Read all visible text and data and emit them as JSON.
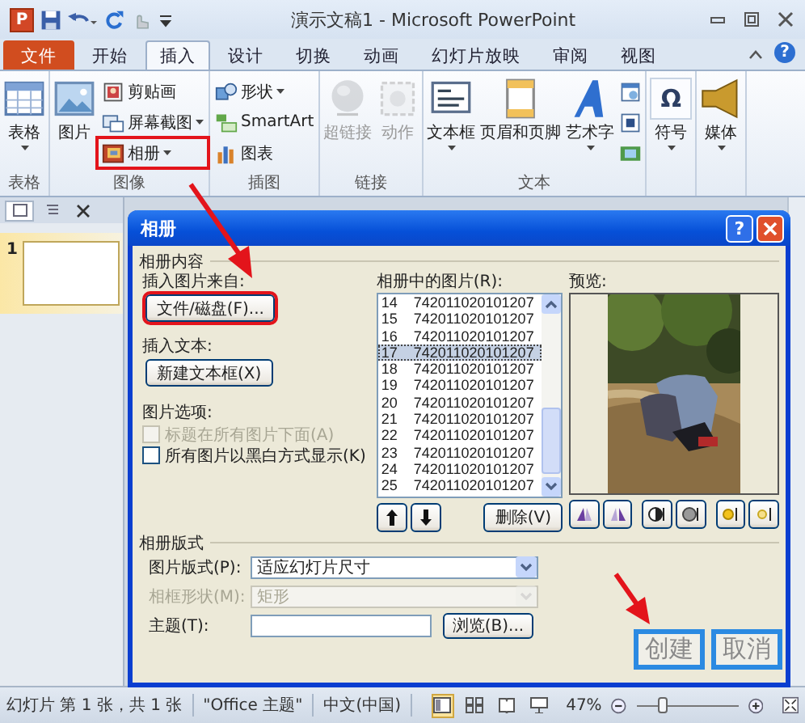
{
  "window": {
    "app_icon": "P",
    "title": "演示文稿1 - Microsoft PowerPoint"
  },
  "ribbon_tabs": [
    {
      "label": "文件",
      "kind": "file",
      "selected": false
    },
    {
      "label": "开始",
      "kind": "tab",
      "selected": false
    },
    {
      "label": "插入",
      "kind": "tab",
      "selected": true
    },
    {
      "label": "设计",
      "kind": "tab",
      "selected": false
    },
    {
      "label": "切换",
      "kind": "tab",
      "selected": false
    },
    {
      "label": "动画",
      "kind": "tab",
      "selected": false
    },
    {
      "label": "幻灯片放映",
      "kind": "tab",
      "selected": false
    },
    {
      "label": "审阅",
      "kind": "tab",
      "selected": false
    },
    {
      "label": "视图",
      "kind": "tab",
      "selected": false
    }
  ],
  "ribbon_help": "?",
  "ribbon_groups": [
    {
      "label": "表格",
      "items": [
        {
          "label": "表格",
          "kind": "large",
          "dropdown": true,
          "disabled": false,
          "marked": false
        }
      ]
    },
    {
      "label": "图像",
      "items": [
        {
          "label": "图片",
          "kind": "large",
          "dropdown": false,
          "disabled": false,
          "marked": false
        },
        {
          "label": "剪贴画",
          "kind": "small",
          "dropdown": false,
          "disabled": false,
          "marked": false
        },
        {
          "label": "屏幕截图",
          "kind": "small",
          "dropdown": true,
          "disabled": false,
          "marked": false
        },
        {
          "label": "相册",
          "kind": "small",
          "dropdown": true,
          "disabled": false,
          "marked": true
        }
      ]
    },
    {
      "label": "插图",
      "items": [
        {
          "label": "形状",
          "kind": "small",
          "dropdown": true,
          "disabled": false,
          "marked": false
        },
        {
          "label": "SmartArt",
          "kind": "small",
          "dropdown": false,
          "disabled": false,
          "marked": false
        },
        {
          "label": "图表",
          "kind": "small",
          "dropdown": false,
          "disabled": false,
          "marked": false
        }
      ]
    },
    {
      "label": "链接",
      "items": [
        {
          "label": "超链接",
          "kind": "large",
          "dropdown": false,
          "disabled": true,
          "marked": false
        },
        {
          "label": "动作",
          "kind": "large",
          "dropdown": false,
          "disabled": true,
          "marked": false
        }
      ]
    },
    {
      "label": "文本",
      "items": [
        {
          "label": "文本框",
          "kind": "large",
          "dropdown": true,
          "disabled": false,
          "marked": false
        },
        {
          "label": "页眉和页脚",
          "kind": "large",
          "dropdown": false,
          "disabled": false,
          "marked": false
        },
        {
          "label": "艺术字",
          "kind": "large",
          "dropdown": true,
          "disabled": false,
          "marked": false
        },
        {
          "kind": "icon",
          "disabled": false,
          "marked": false
        },
        {
          "kind": "icon",
          "disabled": false,
          "marked": false
        },
        {
          "kind": "icon",
          "disabled": false,
          "marked": false
        }
      ]
    },
    {
      "items": [
        {
          "label": "符号",
          "glyph": "Ω",
          "kind": "large",
          "dropdown": true,
          "disabled": false,
          "marked": false
        }
      ]
    },
    {
      "items": [
        {
          "label": "媒体",
          "kind": "large",
          "dropdown": true,
          "disabled": false,
          "marked": false
        }
      ]
    }
  ],
  "slides_pane": {
    "tabs": [
      {
        "kind": "slides",
        "selected": true
      },
      {
        "kind": "outline",
        "selected": false
      }
    ],
    "slides": [
      {
        "number": "1",
        "selected": true
      }
    ]
  },
  "dialog": {
    "title": "相册",
    "help_button": "?",
    "content_section": "相册内容",
    "insert_from_label": "插入图片来自:",
    "file_button": {
      "label": "文件/磁盘(F)...",
      "marked": true
    },
    "insert_text_label": "插入文本:",
    "new_textbox_button": "新建文本框(X)",
    "picture_options_label": "图片选项:",
    "options": [
      {
        "label": "标题在所有图片下面(A)",
        "checked": false,
        "disabled": true
      },
      {
        "label": "所有图片以黑白方式显示(K)",
        "checked": false,
        "disabled": false
      }
    ],
    "pictures_label": "相册中的图片(R):",
    "pictures": [
      {
        "number": "14",
        "name": "742011020101207",
        "selected": false
      },
      {
        "number": "15",
        "name": "742011020101207",
        "selected": false
      },
      {
        "number": "16",
        "name": "742011020101207",
        "selected": false
      },
      {
        "number": "17",
        "name": "742011020101207",
        "selected": true
      },
      {
        "number": "18",
        "name": "742011020101207",
        "selected": false
      },
      {
        "number": "19",
        "name": "742011020101207",
        "selected": false
      },
      {
        "number": "20",
        "name": "742011020101207",
        "selected": false
      },
      {
        "number": "21",
        "name": "742011020101207",
        "selected": false
      },
      {
        "number": "22",
        "name": "742011020101207",
        "selected": false
      },
      {
        "number": "23",
        "name": "742011020101207",
        "selected": false
      },
      {
        "number": "24",
        "name": "742011020101207",
        "selected": false
      },
      {
        "number": "25",
        "name": "742011020101207",
        "selected": false
      }
    ],
    "delete_button": "删除(V)",
    "preview_label": "预览:",
    "layout_section": "相册版式",
    "fields": [
      {
        "label": "图片版式(P):",
        "kind": "select",
        "value": "适应幻灯片尺寸",
        "disabled": false
      },
      {
        "label": "相框形状(M):",
        "kind": "select",
        "value": "矩形",
        "disabled": true
      },
      {
        "label": "主题(T):",
        "kind": "text",
        "button": "浏览(B)...",
        "disabled": false
      }
    ],
    "footer_buttons": [
      {
        "label": "创建",
        "marked": true
      },
      {
        "label": "取消",
        "marked": true
      }
    ]
  },
  "status_bar": {
    "slide_info": "幻灯片 第 1 张，共 1 张",
    "theme": "\"Office 主题\"",
    "language": "中文(中国)",
    "views": [
      {
        "kind": "normal",
        "selected": true
      },
      {
        "kind": "sorter",
        "selected": false
      },
      {
        "kind": "reading",
        "selected": false
      },
      {
        "kind": "slideshow",
        "selected": false
      }
    ],
    "zoom": "47%",
    "zoom_slider": {
      "level": 0.26
    }
  }
}
